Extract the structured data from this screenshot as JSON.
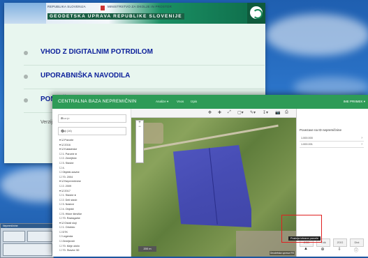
{
  "back_window": {
    "banner": {
      "ministry_left": "REPUBLIKA SLOVENIJA",
      "ministry_right": "MINISTRSTVO ZA OKOLJE IN PROSTOR",
      "agency": "GEODETSKA UPRAVA REPUBLIKE SLOVENIJE"
    },
    "menu": [
      {
        "label": "VHOD Z DIGITALNIM POTRDILOM"
      },
      {
        "label": "UPORABNIŠKA NAVODILA"
      },
      {
        "label": "POMOČ"
      }
    ],
    "version_label": "Verzij"
  },
  "front_window": {
    "app_title": "CENTRALNA BAZA NEPREMIČNIN",
    "top_menu": [
      "Analize ▾",
      "Vnos",
      "Izpis"
    ],
    "user_label": "IME PRIIMEK ▾",
    "search_placeholder": "Iskanje",
    "layers_label": "Sloji (16)",
    "tree_items": [
      "▾ ☑ Parcele",
      "  ▾ ☑ 2016",
      "    ▾ ☑ Katastrske",
      "      ☐ 1. Parcele ●",
      "      ☐ 2. Zemljišče",
      "      ☐ 3. Stavbe",
      "      ☐ 4.",
      "    ☐ Objekti-stavbe",
      "  ☐ 70. 2004",
      "▾ ☑ Nepremičnine",
      "  ☐ 2. 2009",
      "  ▾ ☑ 2017",
      "    ☐ 1. Stavbe ●",
      "    ☐ 2. Deli stavb",
      "    ☐ 3. Naslovi",
      "    ☐ 4. Objekti",
      "    ☐ 5. Hišne številke",
      "  ☐ 70. Razlagalne",
      "▾ ☑ Ostali sloji",
      "  ☐ 1. Ortofoto",
      "  ☐ DTK",
      "  ☐ Legenda",
      "  ☐ Zemljevidi",
      "  ☐ 70. Meje občin",
      "  ☐ 70. Stavbe 3D"
    ],
    "map_tools": [
      "✥",
      "✚",
      "⤢",
      "▢▾",
      "✎▾",
      "↧▾",
      "📷",
      "⎙"
    ],
    "right_panel": {
      "heading": "Povezave na ID nepremičnine",
      "rows": [
        "1.000.000",
        "1.000.001"
      ],
      "tool_labels": [
        "ZCD",
        "Tnik",
        "ZOG",
        "Dist"
      ]
    },
    "tooltip": "Pozicija izbrane parcele",
    "scale_label": "200 m",
    "attribution": "Geodetska uprava RS"
  },
  "mini_window": {
    "title": "Nepremičnine"
  }
}
